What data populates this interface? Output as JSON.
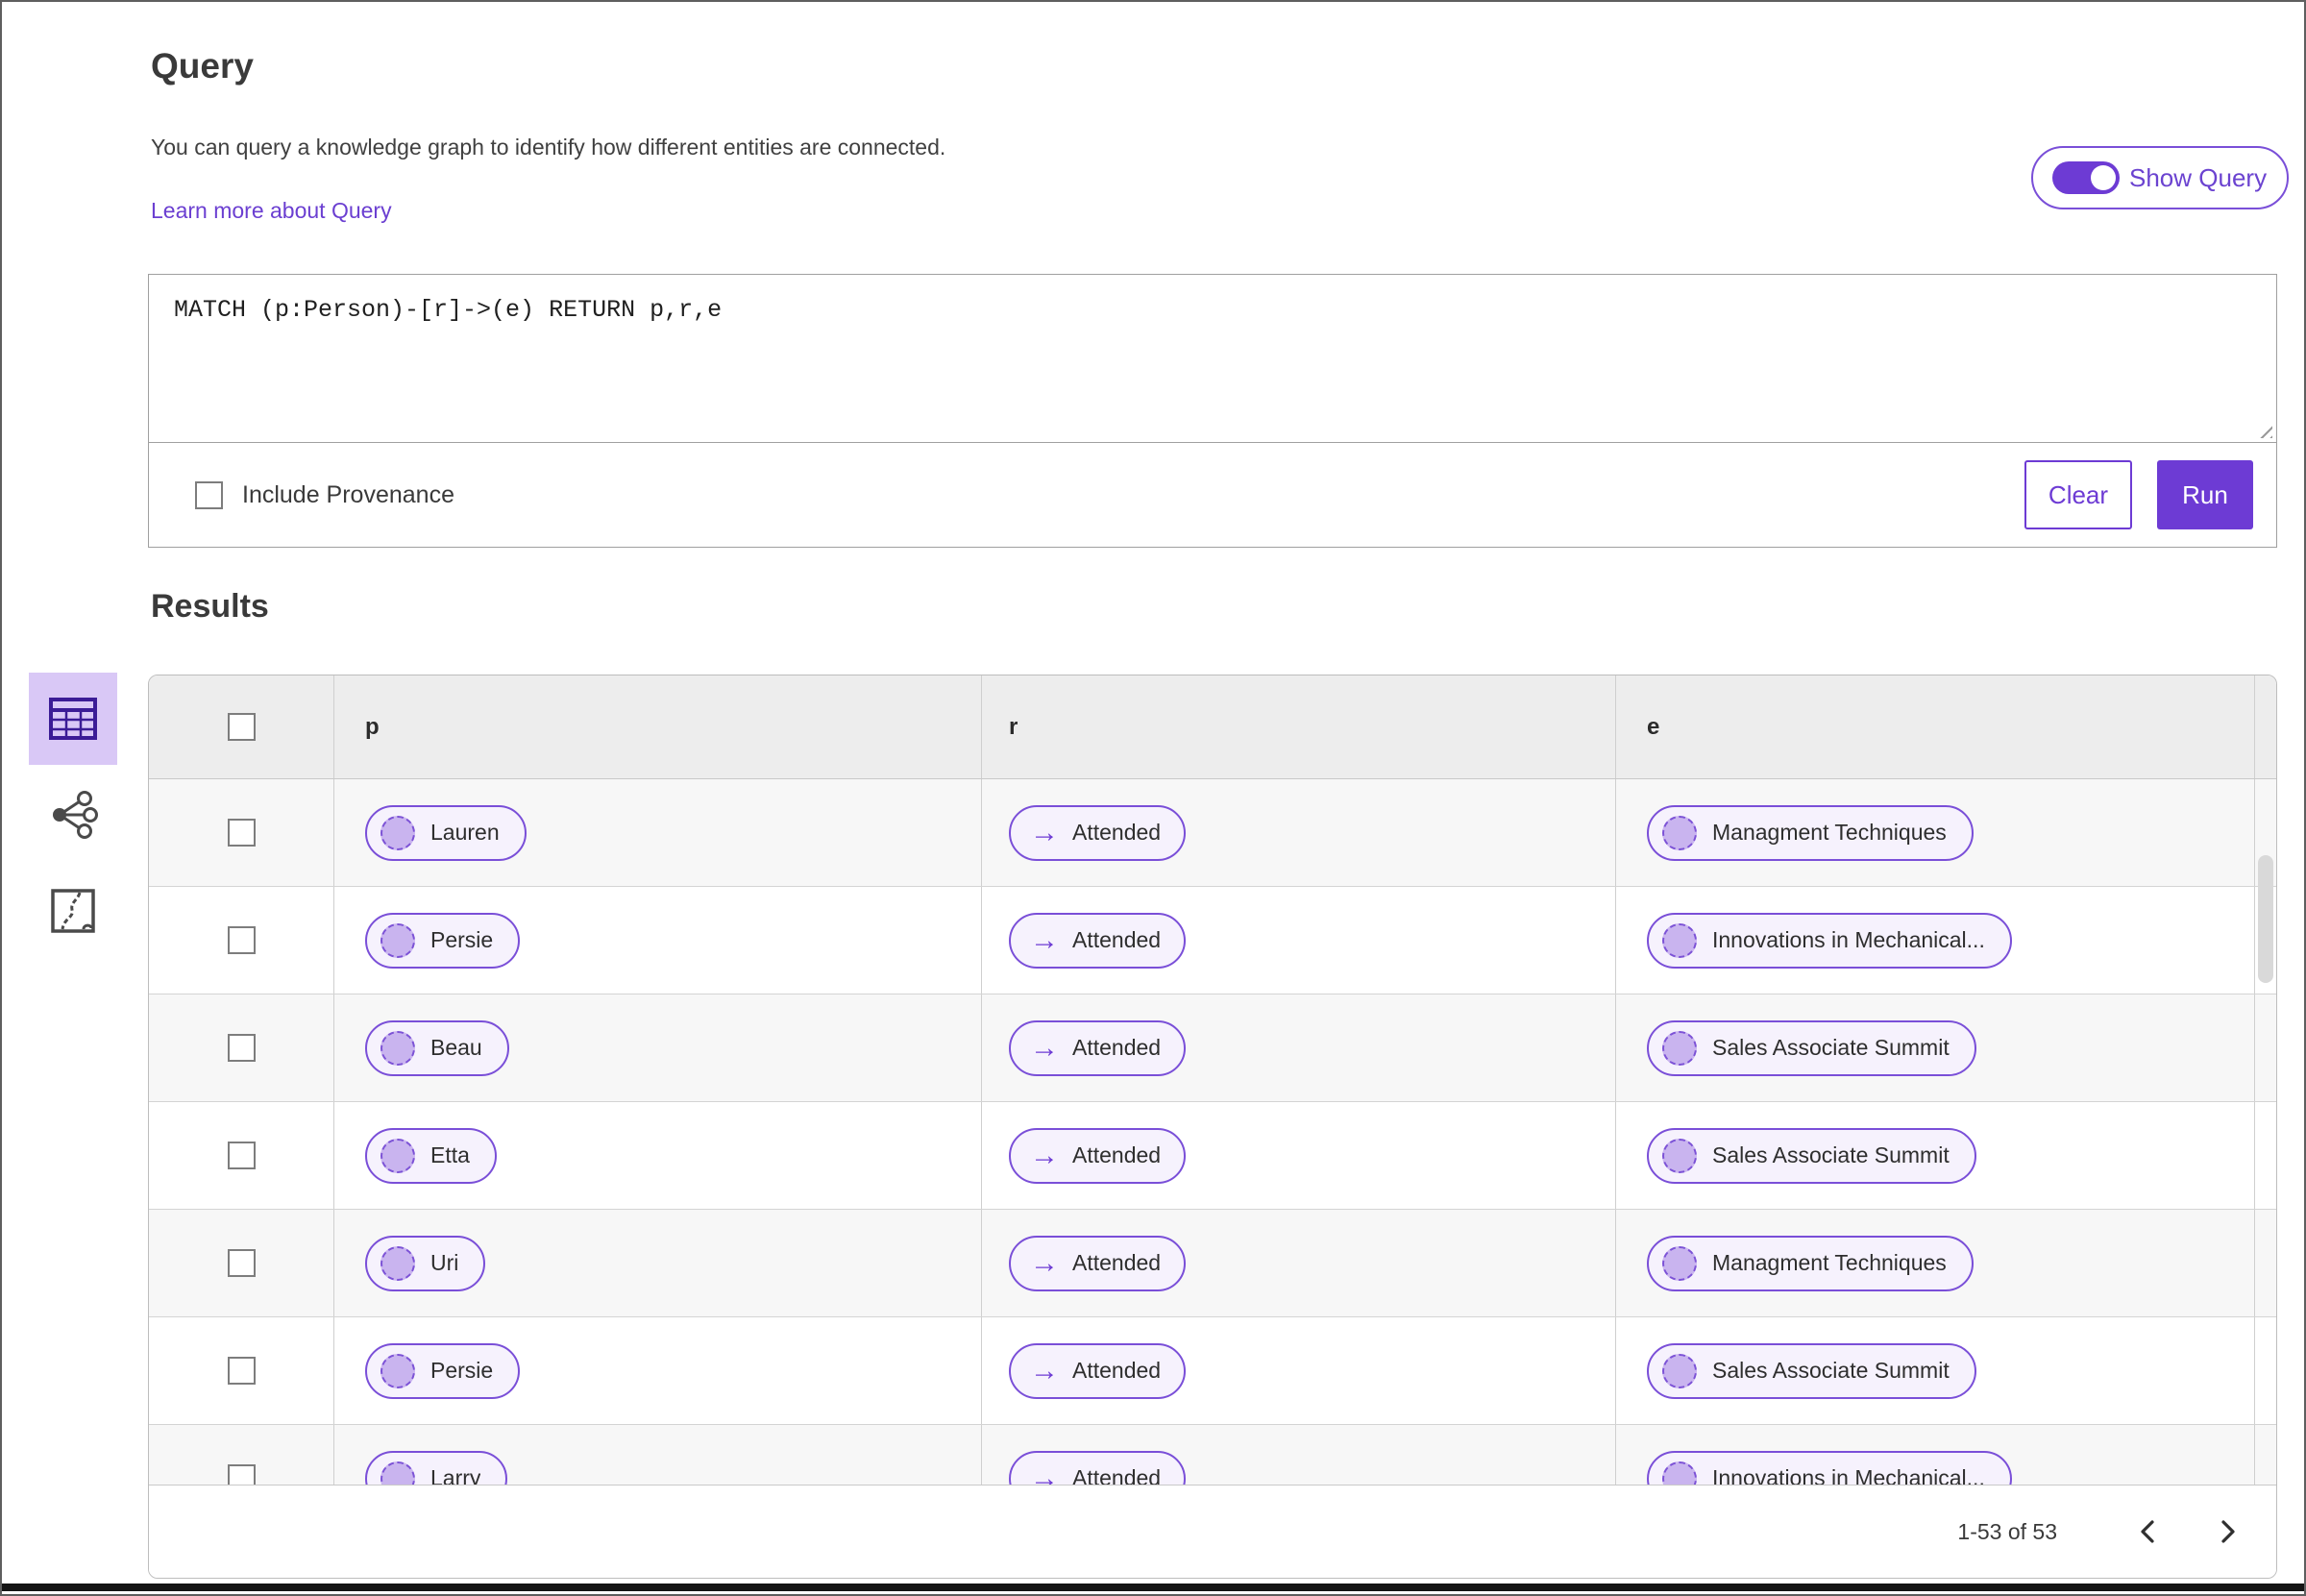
{
  "colors": {
    "accent_purple": "#6d3bd4",
    "link_purple": "#6b3fd1",
    "pill_border": "#7a4fd8",
    "pill_background": "#f6f2fd",
    "node_fill": "#c9b4ef",
    "selected_tile_background": "#d9c8f6",
    "table_header_background": "#ededed",
    "row_stripe": "#f7f7f7"
  },
  "query": {
    "title": "Query",
    "description": "You can query a knowledge graph to identify how different entities are connected.",
    "learn_more_link": "Learn more about Query",
    "show_query_label": "Show Query",
    "show_query_on": true,
    "query_text": "MATCH (p:Person)-[r]->(e) RETURN p,r,e",
    "include_provenance_label": "Include Provenance",
    "include_provenance_checked": false,
    "clear_label": "Clear",
    "run_label": "Run"
  },
  "results": {
    "title": "Results",
    "view_switcher": {
      "items": [
        {
          "icon": "table-view-icon",
          "selected": true
        },
        {
          "icon": "network-view-icon",
          "selected": false
        },
        {
          "icon": "map-view-icon",
          "selected": false
        }
      ]
    },
    "table": {
      "columns": [
        "p",
        "r",
        "e"
      ],
      "relation_arrow_glyph": "→",
      "rows": [
        {
          "p": "Lauren",
          "r": "Attended",
          "e": "Managment Techniques"
        },
        {
          "p": "Persie",
          "r": "Attended",
          "e": "Innovations in Mechanical..."
        },
        {
          "p": "Beau",
          "r": "Attended",
          "e": "Sales Associate Summit"
        },
        {
          "p": "Etta",
          "r": "Attended",
          "e": "Sales Associate Summit"
        },
        {
          "p": "Uri",
          "r": "Attended",
          "e": "Managment Techniques"
        },
        {
          "p": "Persie",
          "r": "Attended",
          "e": "Sales Associate Summit"
        },
        {
          "p": "Larry",
          "r": "Attended",
          "e": "Innovations in Mechanical..."
        }
      ]
    },
    "pagination": {
      "range_label": "1-53 of 53"
    }
  }
}
